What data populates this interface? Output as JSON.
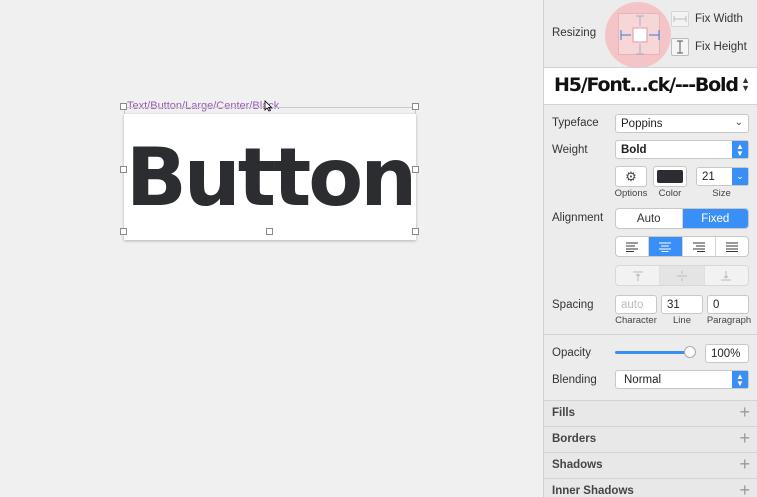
{
  "canvas": {
    "layer_label": "Text/Button/Large/Center/Black",
    "button_text": "Button"
  },
  "inspector": {
    "resizing": {
      "label": "Resizing",
      "fix_width": "Fix Width",
      "fix_height": "Fix Height"
    },
    "style_name": "H5/Font...ck/---Bold",
    "typeface": {
      "label": "Typeface",
      "value": "Poppins"
    },
    "weight": {
      "label": "Weight",
      "value": "Bold"
    },
    "options_label": "Options",
    "color_label": "Color",
    "size": {
      "label": "Size",
      "value": "21"
    },
    "alignment": {
      "label": "Alignment",
      "options": [
        "Auto",
        "Fixed"
      ],
      "selected": "Fixed"
    },
    "spacing": {
      "label": "Spacing",
      "character": {
        "label": "Character",
        "placeholder": "auto"
      },
      "line": {
        "label": "Line",
        "value": "31"
      },
      "paragraph": {
        "label": "Paragraph",
        "value": "0"
      }
    },
    "opacity": {
      "label": "Opacity",
      "value": "100%",
      "level": 1.0
    },
    "blending": {
      "label": "Blending",
      "value": "Normal"
    },
    "sections": [
      {
        "label": "Fills"
      },
      {
        "label": "Borders"
      },
      {
        "label": "Shadows"
      },
      {
        "label": "Inner Shadows"
      }
    ],
    "colors": {
      "accent": "#3a8ff7",
      "text_color_swatch": "#2b2d30",
      "layer_label": "#9b59b6"
    }
  }
}
